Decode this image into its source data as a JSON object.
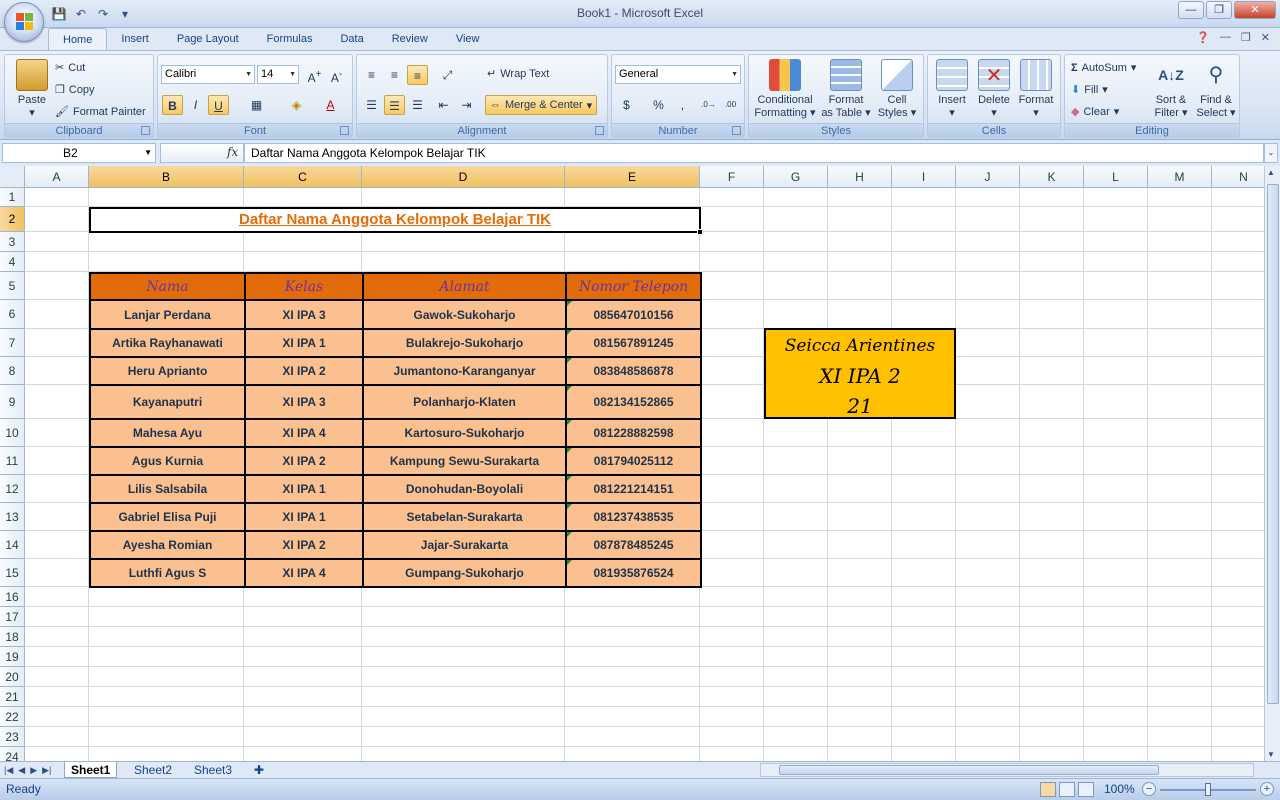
{
  "window": {
    "title": "Book1 - Microsoft Excel"
  },
  "quick_access": {
    "save": "💾",
    "undo": "↶",
    "redo": "↷",
    "customize": "▾"
  },
  "window_controls": {
    "minimize": "—",
    "restore": "❐",
    "close": "✕"
  },
  "ribbon_tabs": [
    "Home",
    "Insert",
    "Page Layout",
    "Formulas",
    "Data",
    "Review",
    "View"
  ],
  "ribbon": {
    "clipboard": {
      "label": "Clipboard",
      "paste": "Paste",
      "cut": "Cut",
      "copy": "Copy",
      "format_painter": "Format Painter"
    },
    "font": {
      "label": "Font",
      "family": "Calibri",
      "size": "14"
    },
    "alignment": {
      "label": "Alignment",
      "wrap_text": "Wrap Text",
      "merge_center": "Merge & Center"
    },
    "number": {
      "label": "Number",
      "format": "General"
    },
    "styles": {
      "label": "Styles",
      "conditional": "Conditional",
      "conditional2": "Formatting",
      "format_table": "Format",
      "format_table2": "as Table",
      "cell_styles": "Cell",
      "cell_styles2": "Styles"
    },
    "cells": {
      "label": "Cells",
      "insert": "Insert",
      "delete": "Delete",
      "format": "Format"
    },
    "editing": {
      "label": "Editing",
      "autosum": "AutoSum",
      "fill": "Fill",
      "clear": "Clear",
      "sort": "Sort &",
      "sort2": "Filter",
      "find": "Find &",
      "find2": "Select"
    }
  },
  "formula_bar": {
    "name_box": "B2",
    "fx": "fx",
    "content": "Daftar Nama Anggota Kelompok Belajar TIK"
  },
  "columns": [
    "A",
    "B",
    "C",
    "D",
    "E",
    "F",
    "G",
    "H",
    "I",
    "J",
    "K",
    "L",
    "M",
    "N"
  ],
  "rows": [
    "1",
    "2",
    "3",
    "4",
    "5",
    "6",
    "7",
    "8",
    "9",
    "10",
    "11",
    "12",
    "13",
    "14",
    "15",
    "16",
    "17",
    "18",
    "19",
    "20",
    "21",
    "22",
    "23",
    "24"
  ],
  "sheet": {
    "title": "Daftar Nama Anggota Kelompok Belajar TIK",
    "headers": [
      "Nama",
      "Kelas",
      "Alamat",
      "Nomor Telepon"
    ],
    "records": [
      [
        "Lanjar Perdana",
        "XI IPA 3",
        "Gawok-Sukoharjo",
        "085647010156"
      ],
      [
        "Artika Rayhanawati",
        "XI IPA 1",
        "Bulakrejo-Sukoharjo",
        "081567891245"
      ],
      [
        "Heru Aprianto",
        "XI IPA 2",
        "Jumantono-Karanganyar",
        "083848586878"
      ],
      [
        "Kayanaputri",
        "XI IPA 3",
        "Polanharjo-Klaten",
        "082134152865"
      ],
      [
        "Mahesa Ayu",
        "XI IPA 4",
        "Kartosuro-Sukoharjo",
        "081228882598"
      ],
      [
        "Agus Kurnia",
        "XI IPA 2",
        "Kampung Sewu-Surakarta",
        "081794025112"
      ],
      [
        "Lilis Salsabila",
        "XI IPA 1",
        "Donohudan-Boyolali",
        "081221214151"
      ],
      [
        "Gabriel Elisa Puji",
        "XI IPA 1",
        "Setabelan-Surakarta",
        "081237438535"
      ],
      [
        "Ayesha Romian",
        "XI IPA 2",
        "Jajar-Surakarta",
        "087878485245"
      ],
      [
        "Luthfi Agus S",
        "XI IPA 4",
        "Gumpang-Sukoharjo",
        "081935876524"
      ]
    ],
    "card": {
      "name": "Seicca Arientines",
      "class": "XI IPA 2",
      "number": "21"
    }
  },
  "sheet_tabs": [
    "Sheet1",
    "Sheet2",
    "Sheet3"
  ],
  "status": {
    "text": "Ready",
    "zoom": "100%",
    "minus": "−",
    "plus": "+"
  }
}
